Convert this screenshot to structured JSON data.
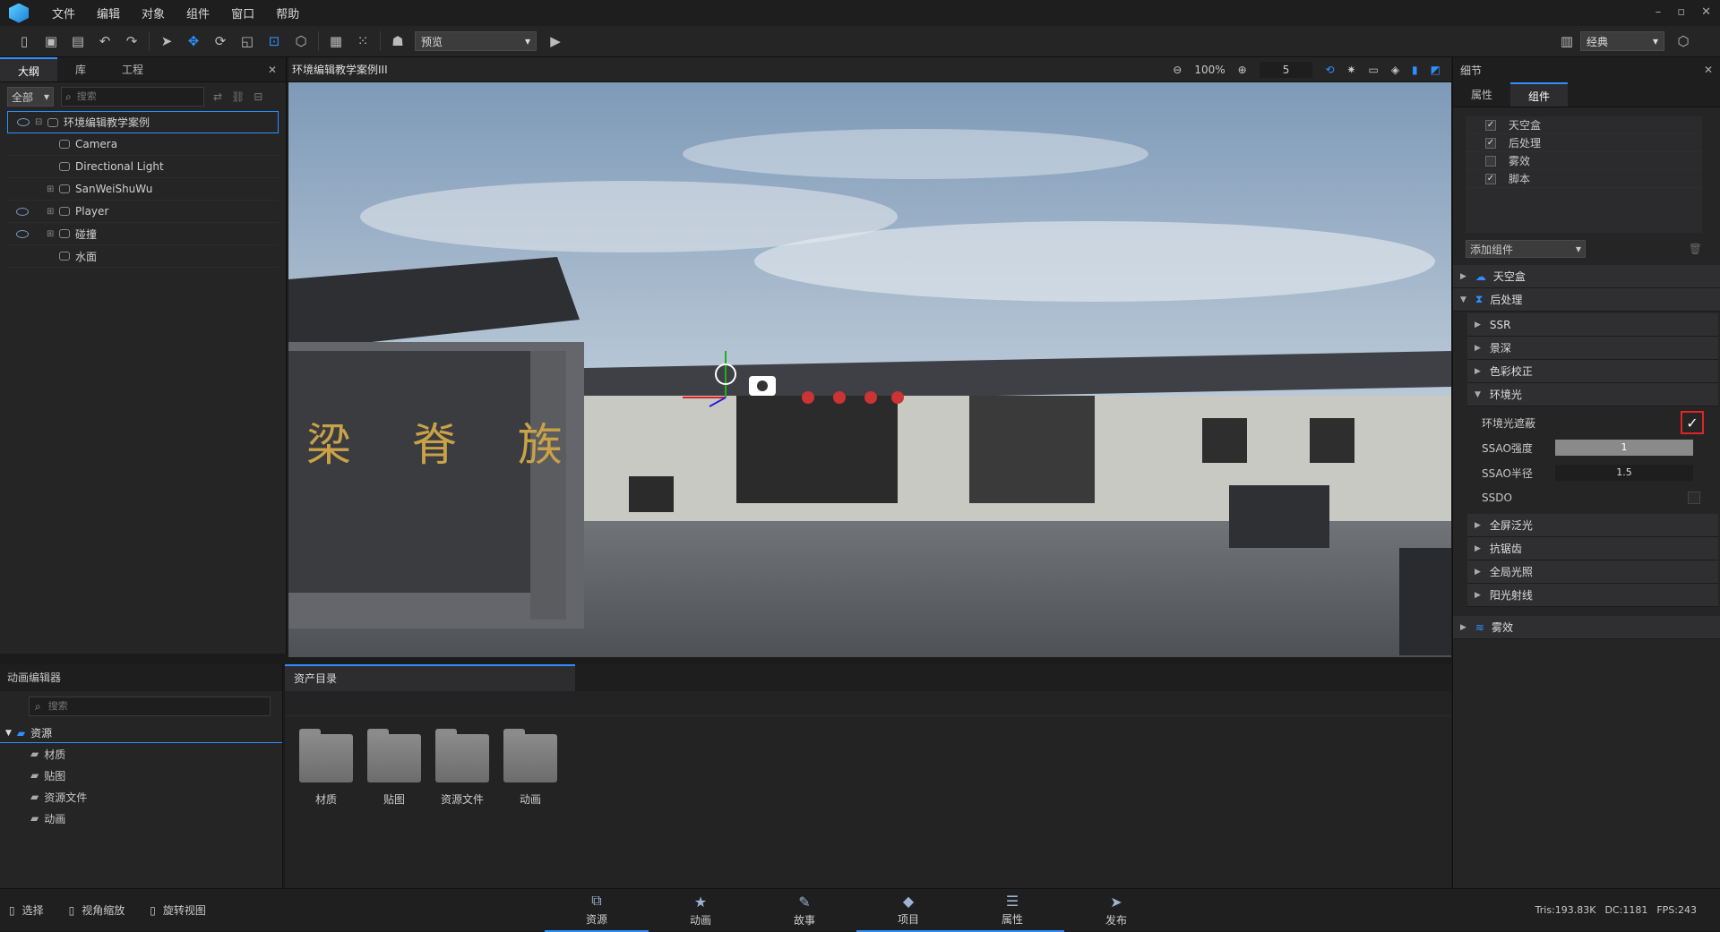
{
  "menu": [
    "文件",
    "编辑",
    "对象",
    "组件",
    "窗口",
    "帮助"
  ],
  "window_controls": [
    "–",
    "▫",
    "✕"
  ],
  "toolbar": {
    "preset": "预览",
    "layout": "经典"
  },
  "outline": {
    "tabs": [
      "大纲",
      "库",
      "工程"
    ],
    "filter": "全部",
    "search_placeholder": "搜索",
    "tree": [
      {
        "label": "环境编辑教学案例",
        "eye": true,
        "exp": "⊟",
        "level": 0
      },
      {
        "label": "Camera",
        "eye": false,
        "exp": "",
        "level": 1
      },
      {
        "label": "Directional Light",
        "eye": false,
        "exp": "",
        "level": 1
      },
      {
        "label": "SanWeiShuWu",
        "eye": false,
        "exp": "⊞",
        "level": 1
      },
      {
        "label": "Player",
        "eye": true,
        "exp": "⊞",
        "level": 1
      },
      {
        "label": "碰撞",
        "eye": true,
        "exp": "⊞",
        "level": 1
      },
      {
        "label": "水面",
        "eye": false,
        "exp": "",
        "level": 1
      }
    ]
  },
  "viewport": {
    "title": "环境编辑教学案例III",
    "zoom": "100%",
    "speed": "5"
  },
  "scene_sign": "梁 脊 族",
  "details": {
    "title": "细节",
    "tabs": [
      "属性",
      "组件"
    ],
    "components": [
      {
        "label": "天空盒",
        "checked": true
      },
      {
        "label": "后处理",
        "checked": true
      },
      {
        "label": "雾效",
        "checked": false
      },
      {
        "label": "脚本",
        "checked": true
      }
    ],
    "add_component": "添加组件",
    "sections": {
      "sky": "天空盒",
      "post": "后处理",
      "ssr": "SSR",
      "dof": "景深",
      "color": "色彩校正",
      "ambient": "环境光",
      "bloom": "全屏泛光",
      "aa": "抗锯齿",
      "gi": "全局光照",
      "rays": "阳光射线",
      "fog": "雾效"
    },
    "ambient_props": {
      "ao_label": "环境光遮蔽",
      "ao_checked": true,
      "ssao_strength_label": "SSAO强度",
      "ssao_strength": "1",
      "ssao_radius_label": "SSAO半径",
      "ssao_radius": "1.5",
      "ssdo_label": "SSDO"
    }
  },
  "anim_editor": {
    "title": "动画编辑器",
    "search_placeholder": "搜索",
    "root": "资源",
    "children": [
      "材质",
      "贴图",
      "资源文件",
      "动画"
    ]
  },
  "assets": {
    "title": "资产目录",
    "folders": [
      "材质",
      "贴图",
      "资源文件",
      "动画"
    ]
  },
  "statusbar": {
    "tools": [
      "选择",
      "视角缩放",
      "旋转视图"
    ],
    "tabs": [
      {
        "label": "资源",
        "icon": "⧉",
        "active": true
      },
      {
        "label": "动画",
        "icon": "★",
        "active": false
      },
      {
        "label": "故事",
        "icon": "✎",
        "active": false
      },
      {
        "label": "项目",
        "icon": "◆",
        "active": true
      },
      {
        "label": "属性",
        "icon": "☰",
        "active": true
      },
      {
        "label": "发布",
        "icon": "➤",
        "active": false
      }
    ],
    "stats": {
      "tris": "Tris:193.83K",
      "dc": "DC:1181",
      "fps": "FPS:243"
    }
  }
}
